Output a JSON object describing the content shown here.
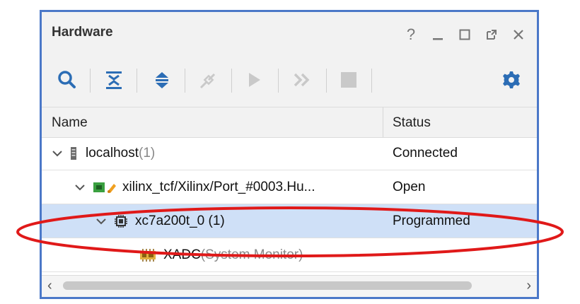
{
  "panel": {
    "title": "Hardware",
    "controls": [
      {
        "name": "help",
        "glyph": "?"
      },
      {
        "name": "minimize",
        "glyph": "_"
      },
      {
        "name": "maximize",
        "glyph": "□"
      },
      {
        "name": "float",
        "glyph": "⧉"
      },
      {
        "name": "close",
        "glyph": "✕"
      }
    ]
  },
  "toolbar": {
    "icons": [
      "search-icon",
      "collapse-all-icon",
      "expand-all-icon",
      "auto-connect-icon",
      "run-icon",
      "run-all-icon",
      "stop-icon",
      "settings-icon"
    ]
  },
  "table": {
    "headers": {
      "name": "Name",
      "status": "Status"
    },
    "rows": [
      {
        "name": "localhost",
        "suffix": " (1)",
        "status": "Connected"
      },
      {
        "name": "xilinx_tcf/Xilinx/Port_#0003.Hu...",
        "suffix": "",
        "status": "Open"
      },
      {
        "name": "xc7a200t_0 (1)",
        "suffix": "",
        "status": "Programmed"
      },
      {
        "name": "XADC",
        "suffix": " (System Monitor)",
        "status": ""
      }
    ]
  },
  "colors": {
    "border": "#4b78c8",
    "selection": "#cfe0f7",
    "highlight_ellipse": "#e01919",
    "icon_blue": "#2c6db5"
  }
}
